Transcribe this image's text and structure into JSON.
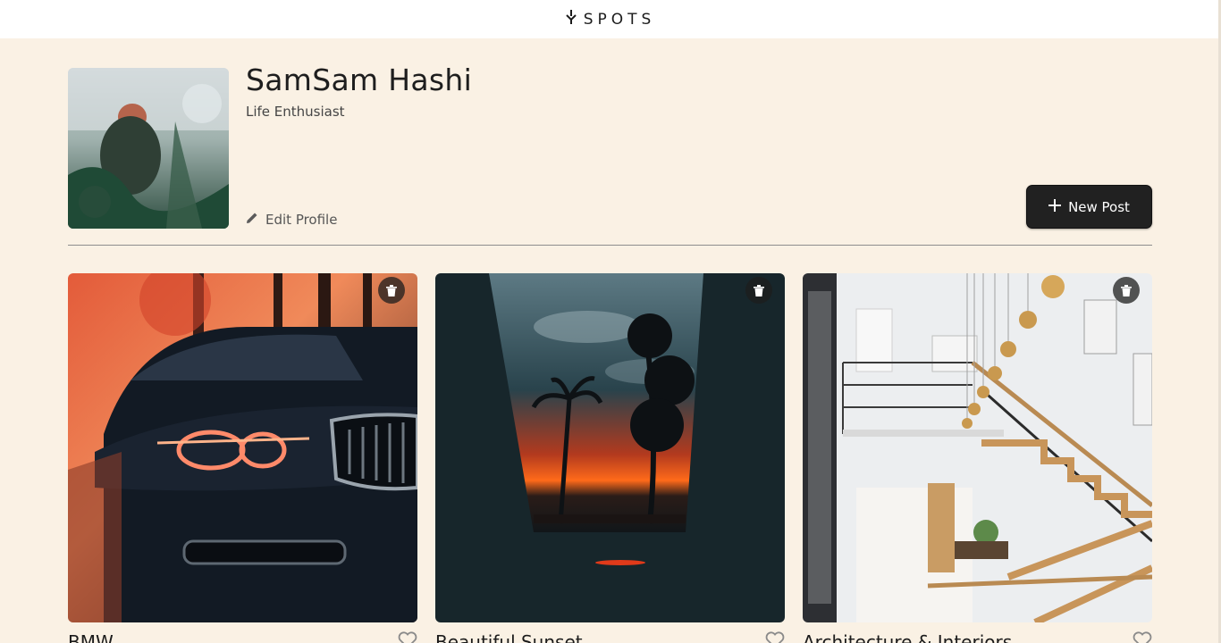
{
  "header": {
    "logo_text": "SPOTS",
    "logo_icon": "fork-icon"
  },
  "profile": {
    "name": "SamSam Hashi",
    "description": "Life Enthusiast",
    "edit_label": "Edit Profile",
    "edit_icon": "pencil-icon"
  },
  "actions": {
    "new_post_label": "New Post",
    "new_post_icon": "plus-icon"
  },
  "cards": [
    {
      "title": "BMW",
      "image": "car-photo",
      "delete_icon": "trash-icon",
      "like_icon": "heart-icon"
    },
    {
      "title": "Beautiful Sunset",
      "image": "sunset-photo",
      "delete_icon": "trash-icon",
      "like_icon": "heart-icon"
    },
    {
      "title": "Architecture & Interiors",
      "image": "staircase-photo",
      "delete_icon": "trash-icon",
      "like_icon": "heart-icon"
    }
  ],
  "colors": {
    "background": "#FAF1E4",
    "header_bg": "#FFFFFF",
    "button_bg": "#212121",
    "text": "#212121"
  }
}
